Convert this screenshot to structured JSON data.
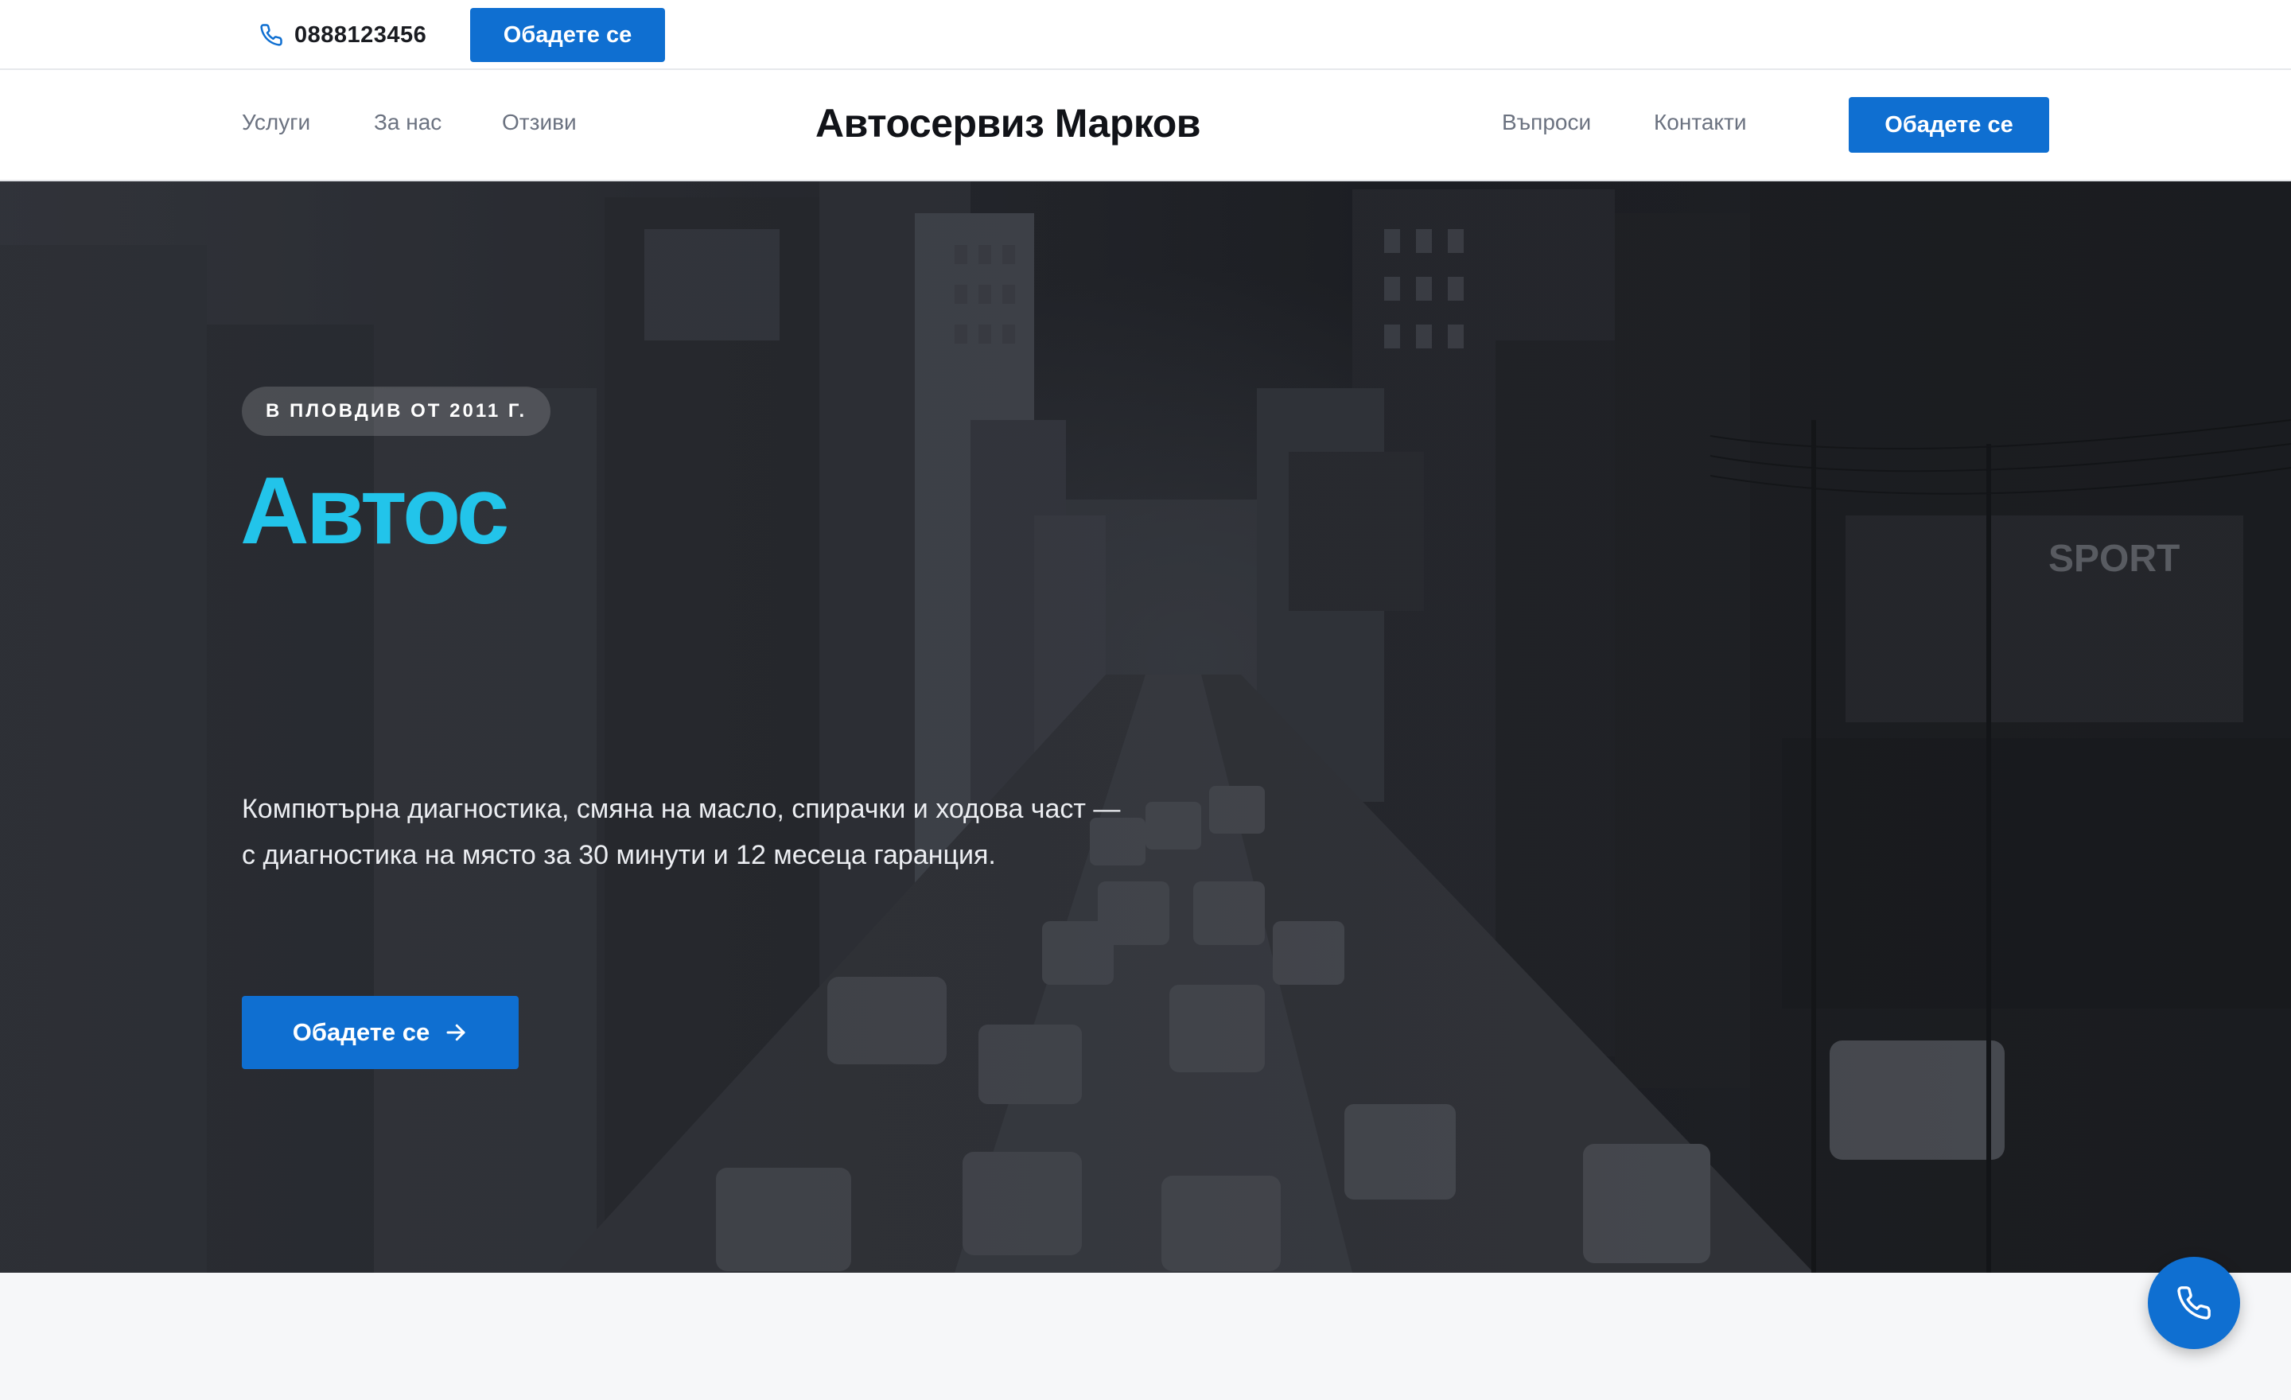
{
  "colors": {
    "accent": "#0f6fd1",
    "hero_title": "#22c4ea",
    "page_bg": "#f6f7f9"
  },
  "topbar": {
    "phone_icon": "phone-icon",
    "phone_number": "0888123456",
    "cta_label": "Обадете се"
  },
  "nav": {
    "left": [
      {
        "label": "Услуги"
      },
      {
        "label": "За нас"
      },
      {
        "label": "Отзиви"
      }
    ],
    "brand": "Автосервиз Марков",
    "right": [
      {
        "label": "Въпроси"
      },
      {
        "label": "Контакти"
      }
    ],
    "cta_label": "Обадете се"
  },
  "hero": {
    "badge": "В ПЛОВДИВ ОТ 2011 Г.",
    "title": "Автос",
    "description": "Компютърна диагностика, смяна на масло, спирачки и ходова част — с диагностика на място за 30 минути и 12 месеца гаранция.",
    "cta_label": "Обадете се",
    "cta_icon": "arrow-right-icon"
  },
  "fab": {
    "icon": "phone-icon"
  }
}
